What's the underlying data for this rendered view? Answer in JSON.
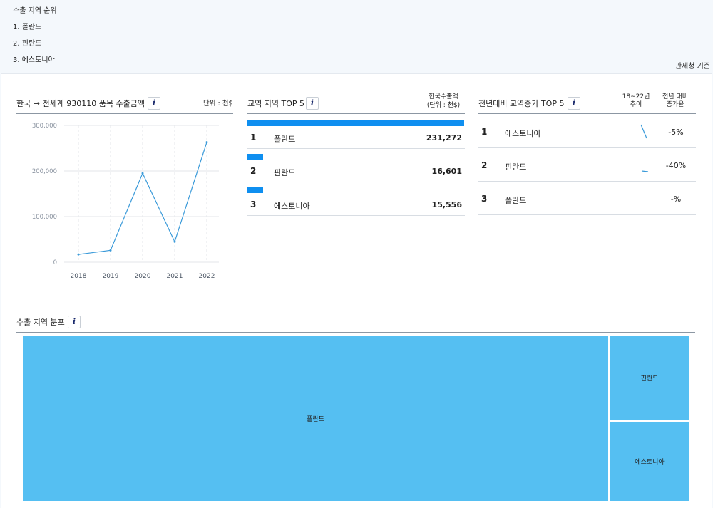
{
  "ranking": {
    "title": "수출 지역 순위",
    "items": [
      "1. 폴란드",
      "2. 핀란드",
      "3. 에스토니아"
    ],
    "source": "관세청 기준"
  },
  "export_panel": {
    "title": "한국 → 전세계 930110 품목  수출금액",
    "unit": "단위 : 천$",
    "info": "i"
  },
  "top5_panel": {
    "title": "교역 지역 TOP 5",
    "info": "i",
    "col_header": "한국수출액",
    "col_unit": "(단위 : 천$)",
    "rows": [
      {
        "rank": "1",
        "name": "폴란드",
        "value": "231,272",
        "share": 1.0
      },
      {
        "rank": "2",
        "name": "핀란드",
        "value": "16,601",
        "share": 0.072
      },
      {
        "rank": "3",
        "name": "에스토니아",
        "value": "15,556",
        "share": 0.067
      }
    ]
  },
  "increase_panel": {
    "title": "전년대비 교역증가 TOP 5",
    "info": "i",
    "col_trend": "18~22년\n추이",
    "col_rate": "전년 대비\n증가율",
    "rows": [
      {
        "rank": "1",
        "name": "에스토니아",
        "rate": "-5%"
      },
      {
        "rank": "2",
        "name": "핀란드",
        "rate": "-40%"
      },
      {
        "rank": "3",
        "name": "폴란드",
        "rate": "-%"
      }
    ]
  },
  "distribution_panel": {
    "title": "수출 지역 분포",
    "info": "i",
    "cells": [
      {
        "name": "폴란드",
        "value": 231272
      },
      {
        "name": "핀란드",
        "value": 16601
      },
      {
        "name": "에스토니아",
        "value": 15556
      }
    ]
  },
  "colors": {
    "line": "#3a9ad9",
    "bar": "#0f8ff0",
    "treemap": "#55bff2"
  },
  "chart_data": {
    "type": "line",
    "x": [
      "2018",
      "2019",
      "2020",
      "2021",
      "2022"
    ],
    "series": [
      {
        "values": [
          17000,
          26000,
          195000,
          45000,
          263000
        ]
      }
    ],
    "xlabel": "",
    "ylabel": "",
    "ylim": [
      0,
      300000
    ],
    "yticks": [
      "0",
      "100,000",
      "200,000",
      "300,000"
    ],
    "grid": true
  }
}
